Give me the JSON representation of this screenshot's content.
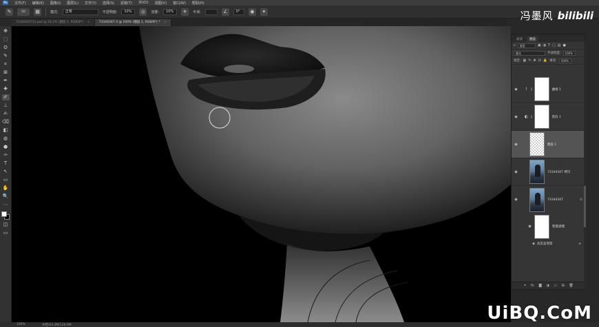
{
  "menu": {
    "logo": "Ps",
    "items": [
      "文件(F)",
      "编辑(E)",
      "图像(I)",
      "图层(L)",
      "文字(Y)",
      "选择(S)",
      "滤镜(T)",
      "3D(D)",
      "视图(V)",
      "窗口(W)",
      "帮助(H)"
    ]
  },
  "options": {
    "brush_size": "50",
    "mode_label": "模式:",
    "mode_value": "正常",
    "opacity_label": "不透明度:",
    "opacity_value": "10%",
    "flow_label": "流量:",
    "flow_value": "10%",
    "smooth_label": "平滑:",
    "angle_value": "0°"
  },
  "watermark": {
    "name": "冯墨风",
    "brand": "bilibili",
    "site": "UiBQ.CoM"
  },
  "tabs": [
    {
      "label": "73344347(1).psd @ 16.2% (图层 1, RGB/8*)",
      "active": false
    },
    {
      "label": "73344347-3 @ 100% (图层 1, RGB/8*) *",
      "active": true
    }
  ],
  "tools": [
    "✥",
    "⬚",
    "ʘ",
    "✎",
    "⌗",
    "⊠",
    "✒",
    "✚",
    "✐",
    "⊥",
    "✍",
    "⌫",
    "◧",
    "◍",
    "●",
    "✑",
    "T",
    "↖",
    "▭",
    "✋",
    "🔍",
    "⋯"
  ],
  "status": {
    "zoom": "100%",
    "doc": "文档:63.3M/128.9M"
  },
  "layers_panel": {
    "tabs": [
      "通道",
      "图层"
    ],
    "filter_kind": "类型",
    "blend_mode": "柔光",
    "opacity_label": "不透明度:",
    "opacity_value": "100%",
    "lock_label": "锁定:",
    "fill_label": "填充:",
    "fill_value": "100%",
    "layers": [
      {
        "name": "曲线 1",
        "thumb": "white",
        "adj": "curves-icon",
        "selected": false
      },
      {
        "name": "黑白 1",
        "thumb": "white",
        "adj": "bw-icon",
        "selected": false
      },
      {
        "name": "图层 1",
        "thumb": "checker",
        "adj": "",
        "selected": true
      },
      {
        "name": "73344347 拷贝",
        "thumb": "photo",
        "adj": "",
        "selected": false
      },
      {
        "name": "73344347",
        "thumb": "photo",
        "adj": "",
        "selected": false
      }
    ],
    "smart_filters_label": "智能滤镜",
    "sub_filter_label": "高反差保留"
  }
}
